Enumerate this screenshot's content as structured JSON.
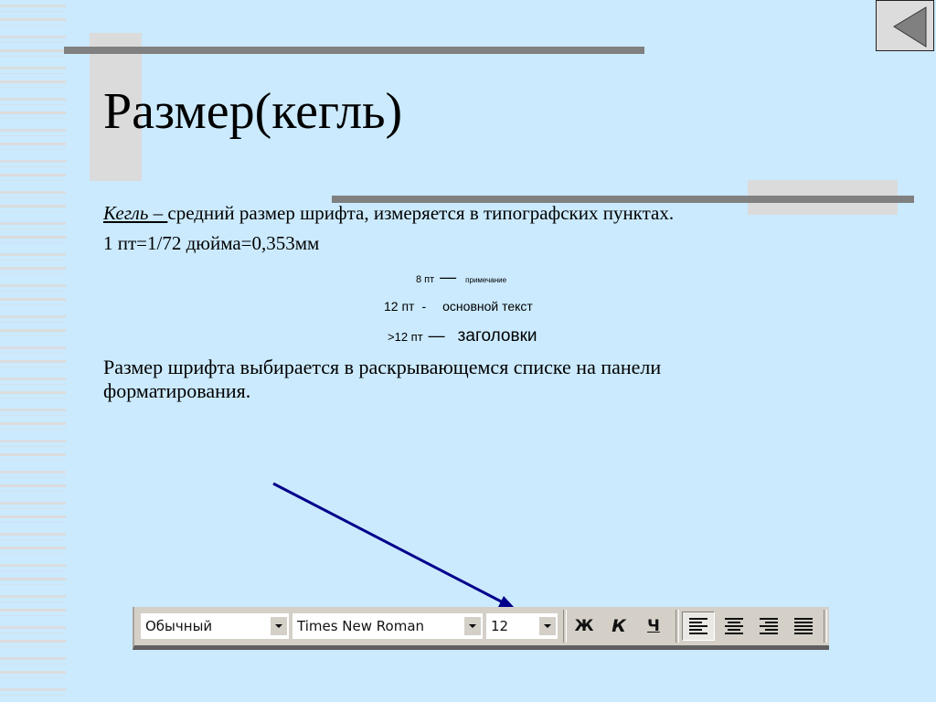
{
  "slide": {
    "title": "Размер(кегль)",
    "definition": {
      "term": "Кегль – ",
      "text": "средний размер шрифта, измеряется в типографских пунктах."
    },
    "conversion": "1 пт=1/72 дюйма=0,353мм",
    "sizes": [
      {
        "size": "8 пт",
        "dash": "—",
        "desc": "примечание"
      },
      {
        "size": "12 пт",
        "dash": "-",
        "desc": "основной текст"
      },
      {
        "size": ">12 пт",
        "dash": "—",
        "desc": "заголовки"
      }
    ],
    "note": "Размер шрифта выбирается в раскрывающемся списке на панели форматирования."
  },
  "navigation": {
    "back_icon": "triangle-left-icon"
  },
  "toolbar": {
    "style": "Обычный",
    "font": "Times New Roman",
    "size": "12",
    "bold_label": "Ж",
    "italic_label": "К",
    "underline_label": "Ч",
    "alignment_selected": "left",
    "alignments": [
      "left",
      "center",
      "right",
      "justify"
    ]
  },
  "colors": {
    "background": "#cbeafe",
    "accent_line": "#808080",
    "arrow": "#00008b"
  }
}
